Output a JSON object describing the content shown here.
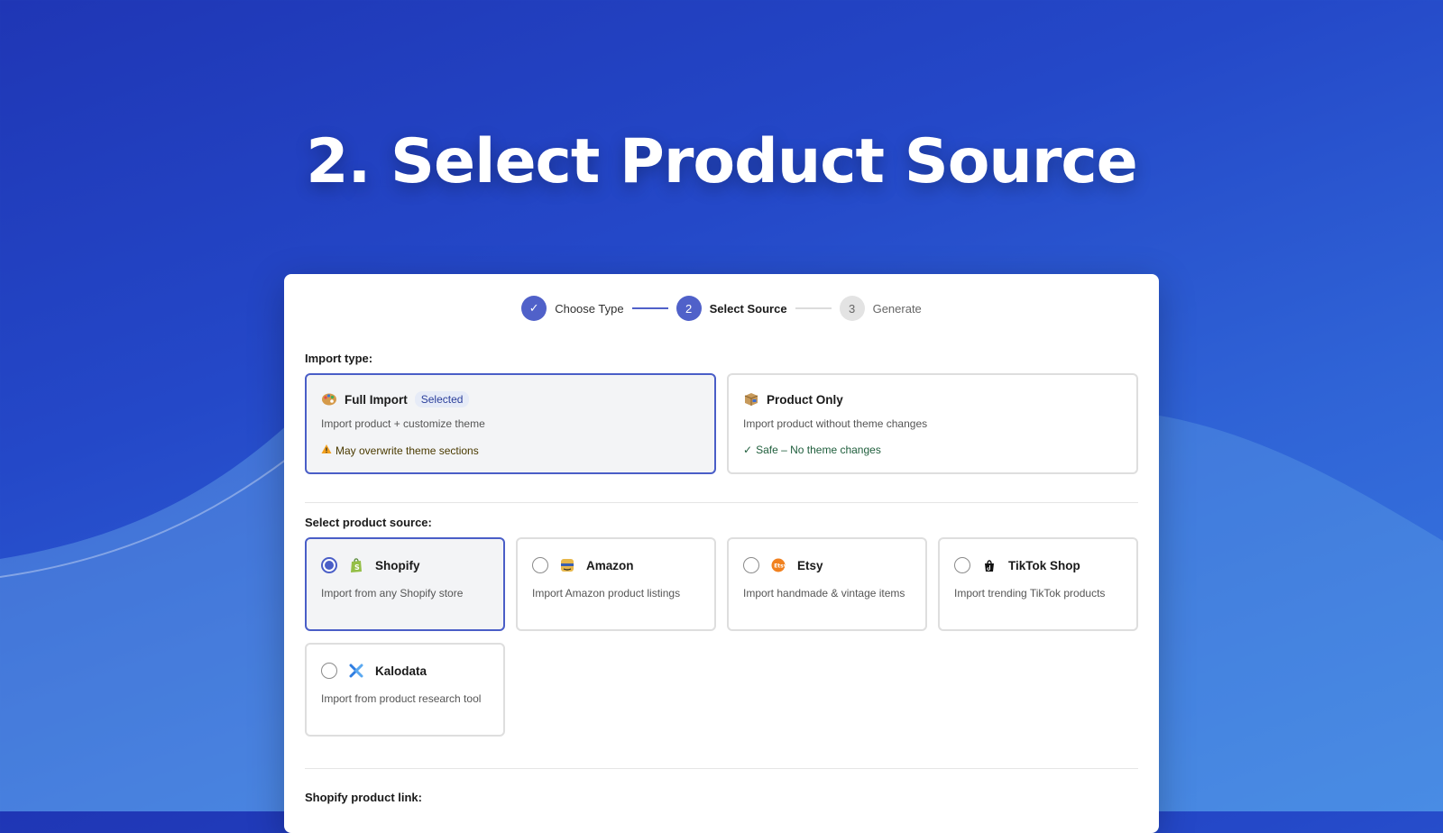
{
  "headline": "2. Select Product Source",
  "stepper": {
    "steps": [
      {
        "label": "Choose Type",
        "state": "done",
        "marker": "✓"
      },
      {
        "label": "Select Source",
        "state": "active",
        "marker": "2"
      },
      {
        "label": "Generate",
        "state": "todo",
        "marker": "3"
      }
    ]
  },
  "import_type": {
    "label": "Import type:",
    "options": [
      {
        "title": "Full Import",
        "badge": "Selected",
        "desc": "Import product + customize theme",
        "note": "May overwrite theme sections",
        "note_color": "#4a3a00",
        "icon": "palette-icon",
        "selected": true
      },
      {
        "title": "Product Only",
        "desc": "Import product without theme changes",
        "note": "Safe – No theme changes",
        "note_color": "#1f5e3c",
        "icon": "package-icon",
        "selected": false
      }
    ]
  },
  "product_source": {
    "label": "Select product source:",
    "options": [
      {
        "title": "Shopify",
        "desc": "Import from any Shopify store",
        "icon": "shopify-icon",
        "selected": true
      },
      {
        "title": "Amazon",
        "desc": "Import Amazon product listings",
        "icon": "amazon-icon",
        "selected": false
      },
      {
        "title": "Etsy",
        "desc": "Import handmade & vintage items",
        "icon": "etsy-icon",
        "selected": false
      },
      {
        "title": "TikTok Shop",
        "desc": "Import trending TikTok products",
        "icon": "tiktok-icon",
        "selected": false
      },
      {
        "title": "Kalodata",
        "desc": "Import from product research tool",
        "icon": "kalodata-icon",
        "selected": false
      }
    ]
  },
  "shopify_link": {
    "label": "Shopify product link:"
  },
  "colors": {
    "accent": "#4a5ec7",
    "background_start": "#1f36b5",
    "background_end": "#3a7be0"
  }
}
